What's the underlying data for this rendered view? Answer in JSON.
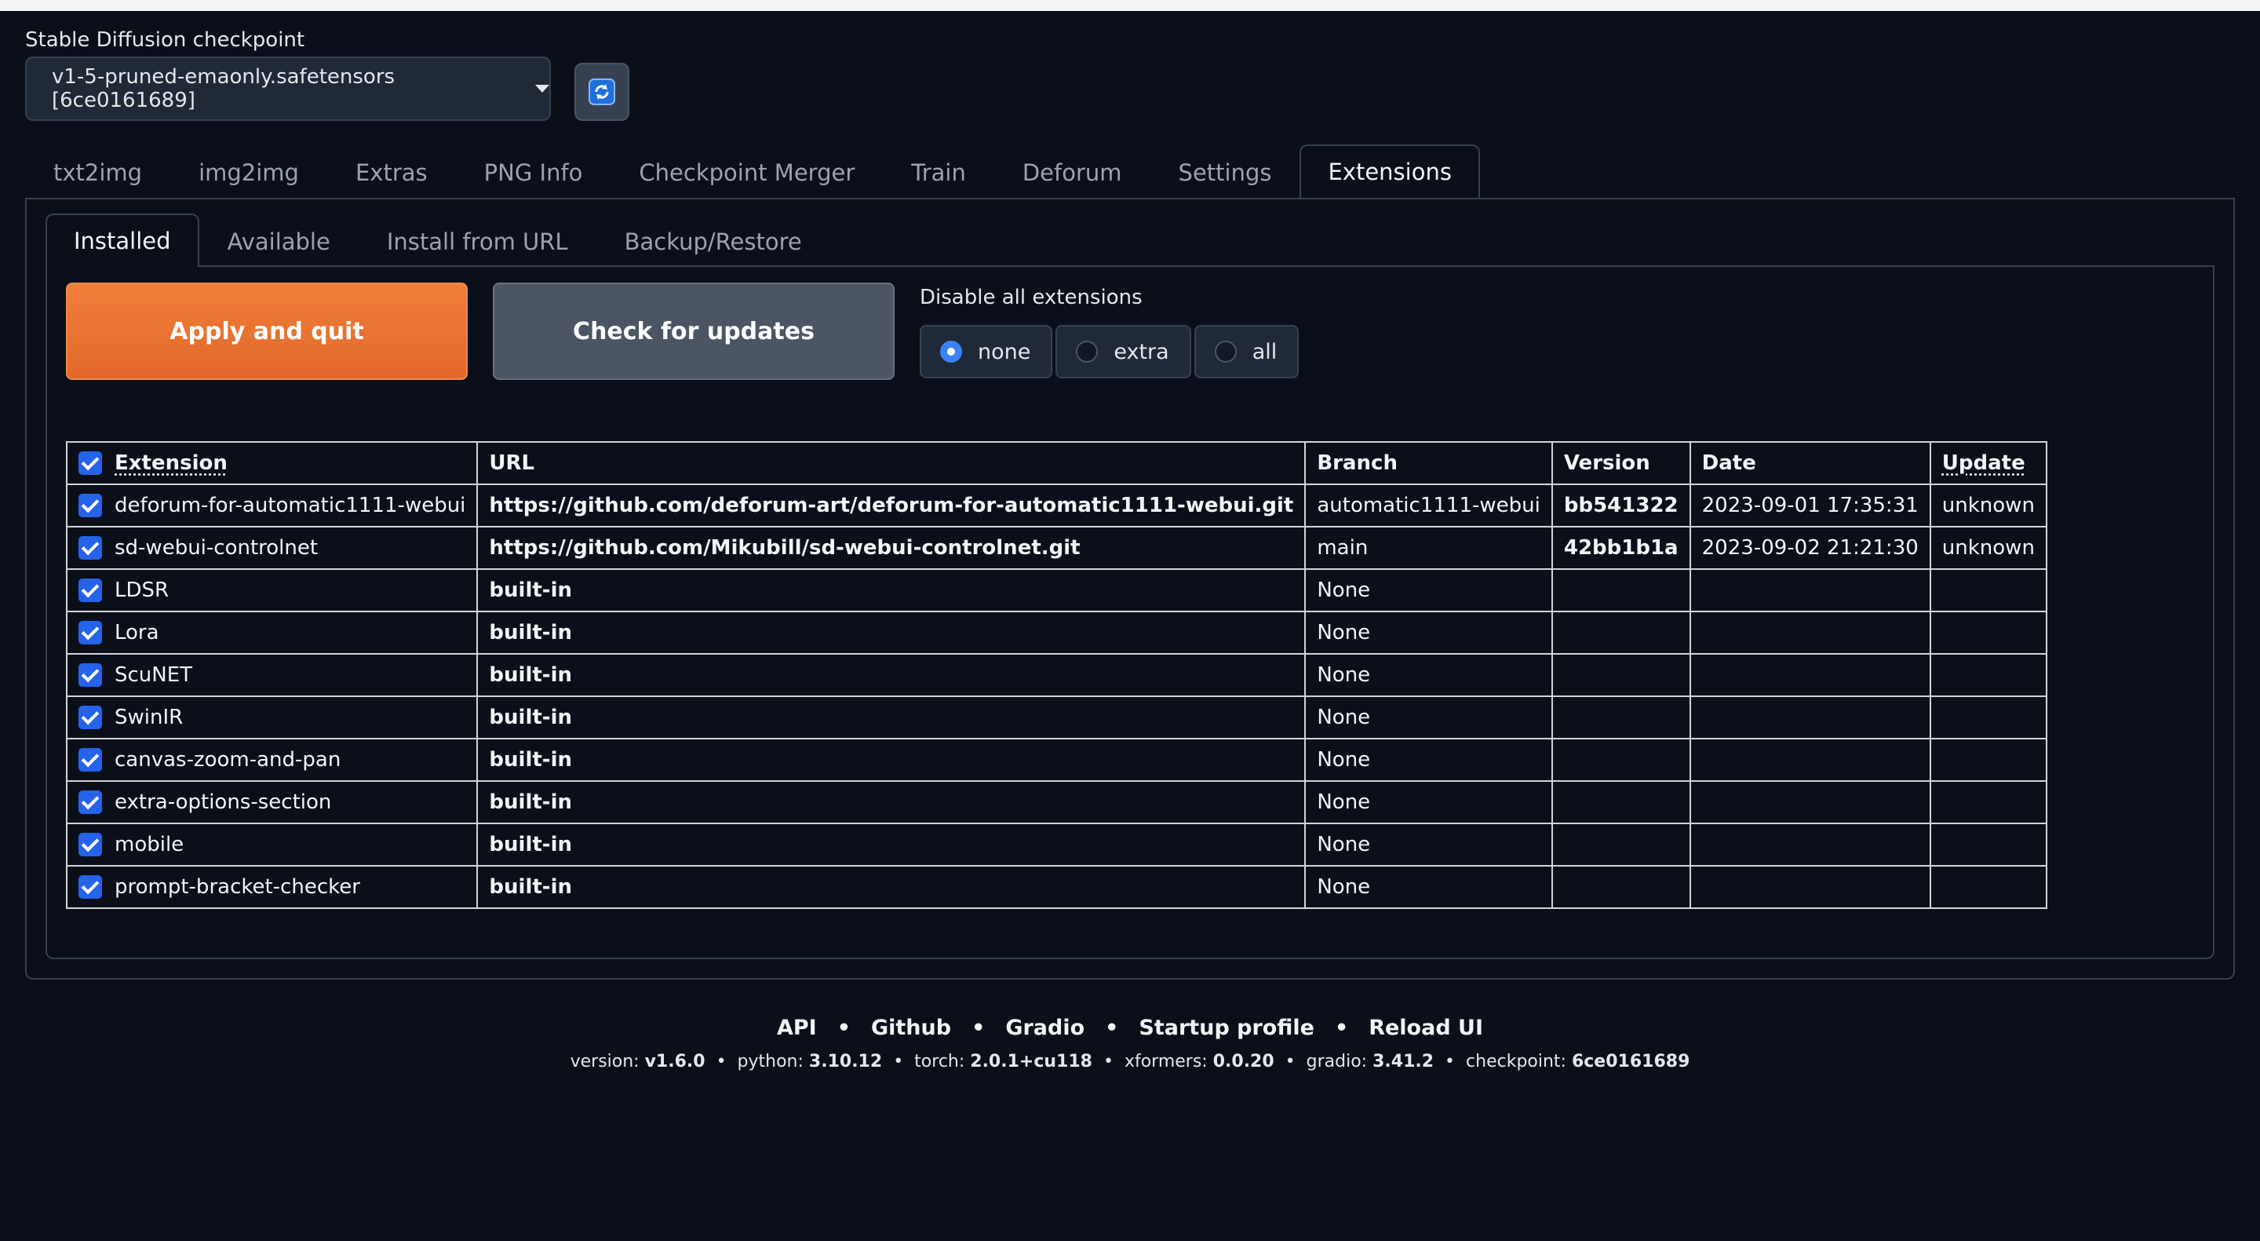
{
  "checkpoint": {
    "label": "Stable Diffusion checkpoint",
    "value": "v1-5-pruned-emaonly.safetensors [6ce0161689]"
  },
  "main_tabs": [
    {
      "label": "txt2img"
    },
    {
      "label": "img2img"
    },
    {
      "label": "Extras"
    },
    {
      "label": "PNG Info"
    },
    {
      "label": "Checkpoint Merger"
    },
    {
      "label": "Train"
    },
    {
      "label": "Deforum"
    },
    {
      "label": "Settings"
    },
    {
      "label": "Extensions",
      "active": true
    }
  ],
  "sub_tabs": [
    {
      "label": "Installed",
      "active": true
    },
    {
      "label": "Available"
    },
    {
      "label": "Install from URL"
    },
    {
      "label": "Backup/Restore"
    }
  ],
  "buttons": {
    "apply": "Apply and quit",
    "check": "Check for updates"
  },
  "disable_all": {
    "label": "Disable all extensions",
    "options": [
      "none",
      "extra",
      "all"
    ],
    "selected": "none"
  },
  "table": {
    "headers": [
      "Extension",
      "URL",
      "Branch",
      "Version",
      "Date",
      "Update"
    ],
    "rows": [
      {
        "ext": "deforum-for-automatic1111-webui",
        "url": "https://github.com/deforum-art/deforum-for-automatic1111-webui.git",
        "branch": "automatic1111-webui",
        "version": "bb541322",
        "date": "2023-09-01 17:35:31",
        "update": "unknown"
      },
      {
        "ext": "sd-webui-controlnet",
        "url": "https://github.com/Mikubill/sd-webui-controlnet.git",
        "branch": "main",
        "version": "42bb1b1a",
        "date": "2023-09-02 21:21:30",
        "update": "unknown"
      },
      {
        "ext": "LDSR",
        "url": "built-in",
        "branch": "None",
        "version": "",
        "date": "",
        "update": ""
      },
      {
        "ext": "Lora",
        "url": "built-in",
        "branch": "None",
        "version": "",
        "date": "",
        "update": ""
      },
      {
        "ext": "ScuNET",
        "url": "built-in",
        "branch": "None",
        "version": "",
        "date": "",
        "update": ""
      },
      {
        "ext": "SwinIR",
        "url": "built-in",
        "branch": "None",
        "version": "",
        "date": "",
        "update": ""
      },
      {
        "ext": "canvas-zoom-and-pan",
        "url": "built-in",
        "branch": "None",
        "version": "",
        "date": "",
        "update": ""
      },
      {
        "ext": "extra-options-section",
        "url": "built-in",
        "branch": "None",
        "version": "",
        "date": "",
        "update": ""
      },
      {
        "ext": "mobile",
        "url": "built-in",
        "branch": "None",
        "version": "",
        "date": "",
        "update": ""
      },
      {
        "ext": "prompt-bracket-checker",
        "url": "built-in",
        "branch": "None",
        "version": "",
        "date": "",
        "update": ""
      }
    ]
  },
  "footer": {
    "links": [
      "API",
      "Github",
      "Gradio",
      "Startup profile",
      "Reload UI"
    ],
    "info": [
      {
        "label": "version: ",
        "value": "v1.6.0"
      },
      {
        "label": "python: ",
        "value": "3.10.12"
      },
      {
        "label": "torch: ",
        "value": "2.0.1+cu118"
      },
      {
        "label": "xformers: ",
        "value": "0.0.20"
      },
      {
        "label": "gradio: ",
        "value": "3.41.2"
      },
      {
        "label": "checkpoint: ",
        "value": "6ce0161689"
      }
    ]
  },
  "colors": {
    "background": "#0b0f19",
    "accent_orange": "#e2682a",
    "checkbox_blue": "#2563eb"
  },
  "icons": {
    "refresh": "refresh-icon",
    "dropdown": "chevron-down-icon"
  }
}
